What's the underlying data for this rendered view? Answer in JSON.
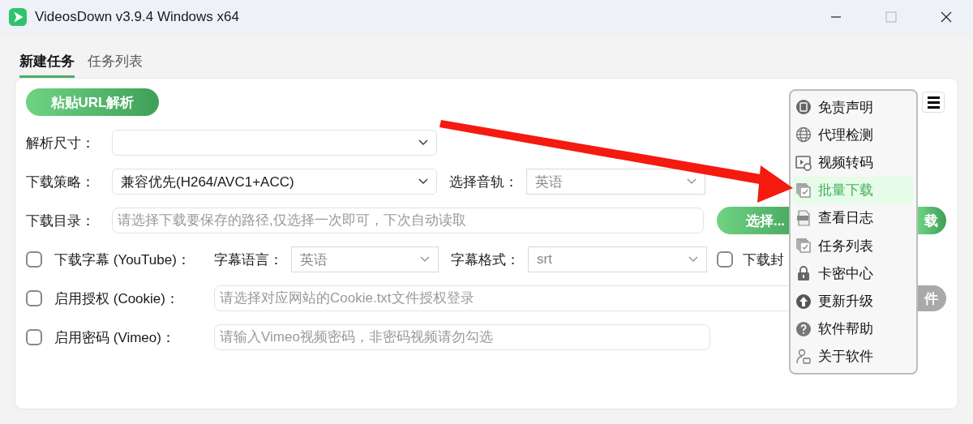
{
  "window": {
    "title": "VideosDown v3.9.4 Windows x64"
  },
  "tabs": [
    {
      "label": "新建任务",
      "selected": true
    },
    {
      "label": "任务列表",
      "selected": false
    }
  ],
  "paste_button": "粘贴URL解析",
  "resolution": {
    "label": "解析尺寸："
  },
  "strategy": {
    "label": "下载策略：",
    "value": "兼容优先(H264/AVC1+ACC)"
  },
  "audio_track": {
    "label": "选择音轨：",
    "value": "英语"
  },
  "directory": {
    "label": "下载目录：",
    "placeholder": "请选择下载要保存的路径,仅选择一次即可，下次自动读取",
    "select_button": "选择...",
    "download_button": "载"
  },
  "subtitles": {
    "checked": false,
    "label": "下载字幕 (YouTube)：",
    "language_label": "字幕语言：",
    "language": "英语",
    "format_label": "字幕格式：",
    "format": "srt"
  },
  "cover": {
    "checked": false,
    "label": "下载封"
  },
  "cookie": {
    "checked": false,
    "label": "启用授权 (Cookie)：",
    "placeholder": "请选择对应网站的Cookie.txt文件授权登录",
    "button": "件"
  },
  "password": {
    "checked": false,
    "label": "启用密码 (Vimeo)：",
    "placeholder": "请输入Vimeo视频密码，非密码视频请勿勾选"
  },
  "menu": [
    {
      "label": "免责声明",
      "selected": false
    },
    {
      "label": "代理检测",
      "selected": false
    },
    {
      "label": "视频转码",
      "selected": false
    },
    {
      "label": "批量下载",
      "selected": true
    },
    {
      "label": "查看日志",
      "selected": false
    },
    {
      "label": "任务列表",
      "selected": false
    },
    {
      "label": "卡密中心",
      "selected": false
    },
    {
      "label": "更新升级",
      "selected": false
    },
    {
      "label": "软件帮助",
      "selected": false
    },
    {
      "label": "关于软件",
      "selected": false
    }
  ]
}
